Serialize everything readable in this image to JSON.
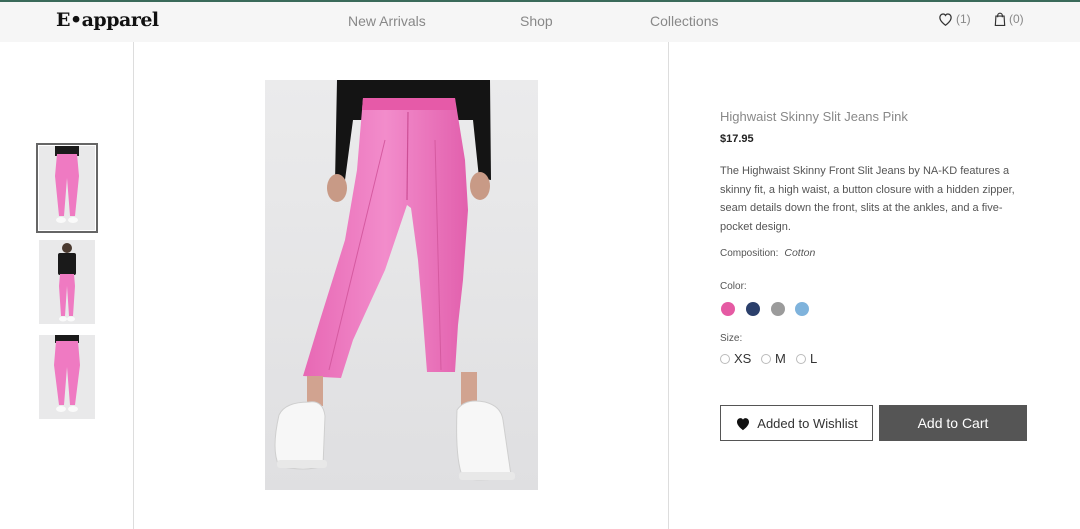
{
  "header": {
    "logo": "E•apparel",
    "nav": [
      "New Arrivals",
      "Shop",
      "Collections"
    ],
    "wishlist_count": "(1)",
    "cart_count": "(0)"
  },
  "thumbnails": [
    {
      "alt": "front-crop"
    },
    {
      "alt": "full-body"
    },
    {
      "alt": "back-crop"
    }
  ],
  "product": {
    "name": "Highwaist Skinny Slit Jeans Pink",
    "price": "$17.95",
    "description": "The Highwaist Skinny Front Slit Jeans by NA-KD features a skinny fit, a high waist, a button closure with a hidden zipper, seam details down the front, slits at the ankles, and a five-pocket design.",
    "composition_label": "Composition:",
    "composition_value": "Cotton",
    "color_label": "Color:",
    "colors": [
      "#e55aa3",
      "#2b3f6b",
      "#9b9b9b",
      "#7fb3dc"
    ],
    "size_label": "Size:",
    "sizes": [
      "XS",
      "M",
      "L"
    ],
    "wishlist_button": "Added to Wishlist",
    "cart_button": "Add to Cart"
  },
  "icons": {
    "wishlist": "heart-outline-icon",
    "cart": "shopping-bag-icon",
    "wishlist_button": "heart-filled-icon"
  }
}
